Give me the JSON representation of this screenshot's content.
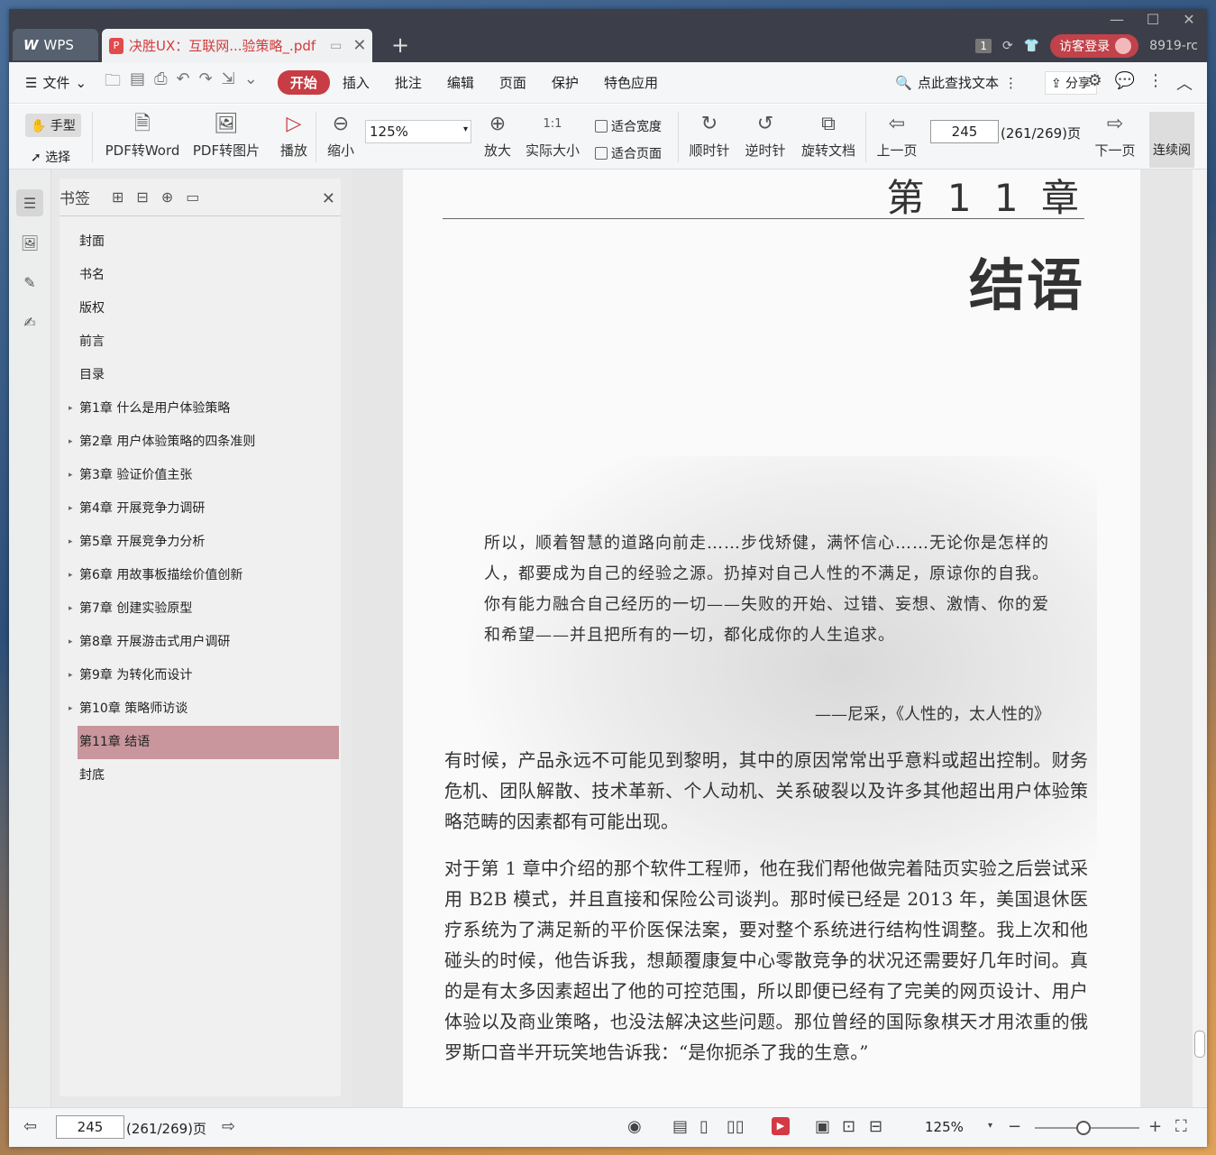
{
  "titlebar": {
    "app_tab": "WPS",
    "doc_tab": "决胜UX：互联网...验策略_.pdf",
    "badge": "1",
    "login_btn": "访客登录",
    "version": "8919-rc"
  },
  "menubar": {
    "file": "文件",
    "tabs": [
      "开始",
      "插入",
      "批注",
      "编辑",
      "页面",
      "保护",
      "特色应用"
    ],
    "search_text": "点此查找文本",
    "share": "分享"
  },
  "toolbar": {
    "hand": "手型",
    "select": "选择",
    "pdf_to_word": "PDF转Word",
    "pdf_to_image": "PDF转图片",
    "play": "播放",
    "zoom_out": "缩小",
    "zoom_value": "125%",
    "zoom_in": "放大",
    "actual_size": "实际大小",
    "fit_width": "适合宽度",
    "fit_page": "适合页面",
    "clockwise": "顺时针",
    "counterclockwise": "逆时针",
    "rotate_doc": "旋转文档",
    "prev_page": "上一页",
    "page_input": "245",
    "page_count": "(261/269)页",
    "next_page": "下一页",
    "continuous": "连续阅"
  },
  "panel": {
    "title": "书签",
    "items": [
      {
        "label": "封面",
        "expandable": false
      },
      {
        "label": "书名",
        "expandable": false
      },
      {
        "label": "版权",
        "expandable": false
      },
      {
        "label": "前言",
        "expandable": false
      },
      {
        "label": "目录",
        "expandable": false
      },
      {
        "label": "第1章 什么是用户体验策略",
        "expandable": true
      },
      {
        "label": "第2章 用户体验策略的四条准则",
        "expandable": true
      },
      {
        "label": "第3章 验证价值主张",
        "expandable": true
      },
      {
        "label": "第4章 开展竞争力调研",
        "expandable": true
      },
      {
        "label": "第5章 开展竞争力分析",
        "expandable": true
      },
      {
        "label": "第6章 用故事板描绘价值创新",
        "expandable": true
      },
      {
        "label": "第7章 创建实验原型",
        "expandable": true
      },
      {
        "label": "第8章 开展游击式用户调研",
        "expandable": true
      },
      {
        "label": "第9章 为转化而设计",
        "expandable": true
      },
      {
        "label": "第10章 策略师访谈",
        "expandable": true
      },
      {
        "label": "第11章 结语",
        "expandable": false,
        "selected": true
      },
      {
        "label": "封底",
        "expandable": false
      }
    ]
  },
  "page": {
    "chapter_no": "第 1 1 章",
    "chapter_title": "结语",
    "quote": "所以，顺着智慧的道路向前走……步伐矫健，满怀信心……无论你是怎样的人，都要成为自己的经验之源。扔掉对自己人性的不满足，原谅你的自我。你有能力融合自己经历的一切——失败的开始、过错、妄想、激情、你的爱和希望——并且把所有的一切，都化成你的人生追求。",
    "attribution": "——尼采，《人性的，太人性的》",
    "para1": "有时候，产品永远不可能见到黎明，其中的原因常常出乎意料或超出控制。财务危机、团队解散、技术革新、个人动机、关系破裂以及许多其他超出用户体验策略范畴的因素都有可能出现。",
    "para2": "对于第 1 章中介绍的那个软件工程师，他在我们帮他做完着陆页实验之后尝试采用 B2B 模式，并且直接和保险公司谈判。那时候已经是 2013 年，美国退休医疗系统为了满足新的平价医保法案，要对整个系统进行结构性调整。我上次和他碰头的时候，他告诉我，想颠覆康复中心零散竞争的状况还需要好几年时间。真的是有太多因素超出了他的可控范围，所以即便已经有了完美的网页设计、用户体验以及商业策略，也没法解决这些问题。那位曾经的国际象棋天才用浓重的俄罗斯口音半开玩笑地告诉我：“是你扼杀了我的生意。”"
  },
  "statusbar": {
    "page_input": "245",
    "page_count": "(261/269)页",
    "zoom": "125%"
  }
}
